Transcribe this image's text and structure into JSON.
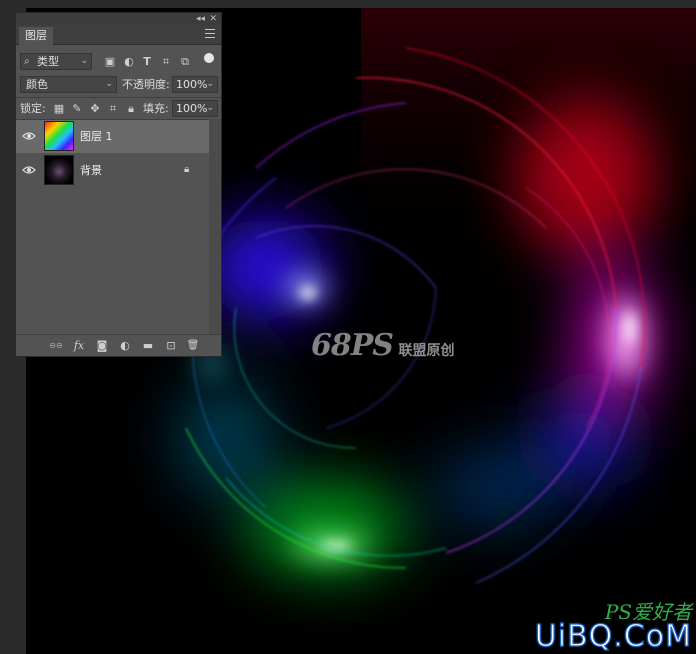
{
  "panel": {
    "title_buttons": {
      "collapse": "◂◂",
      "close": "✕"
    },
    "tab_label": "图层",
    "menu_icon": "panel-menu-icon",
    "filter": {
      "label": "类型",
      "icon": "search-icon",
      "filter_icons": [
        "image-filter-icon",
        "adjustment-filter-icon",
        "type-filter-icon",
        "shape-filter-icon",
        "smart-object-filter-icon",
        "filter-toggle-icon"
      ]
    },
    "blend_mode": "颜色",
    "opacity_label": "不透明度:",
    "opacity_value": "100%",
    "lock_label": "锁定:",
    "lock_icons": [
      "lock-transparent-icon",
      "lock-pixels-icon",
      "lock-position-icon",
      "lock-artboard-icon",
      "lock-all-icon"
    ],
    "fill_label": "填充:",
    "fill_value": "100%",
    "layers": [
      {
        "name": "图层 1",
        "visible": true,
        "selected": true,
        "locked": false,
        "thumb": "rainbow-gradient"
      },
      {
        "name": "背景",
        "visible": true,
        "selected": false,
        "locked": true,
        "thumb": "dark-swirl"
      }
    ],
    "footer_icons": [
      "link-layers-icon",
      "fx-icon",
      "add-mask-icon",
      "adjustment-layer-icon",
      "new-group-icon",
      "new-layer-icon",
      "delete-layer-icon"
    ],
    "footer_glyphs": {
      "link": "⊖⊖",
      "fx": "fx",
      "mask": "◙",
      "adjust": "◐",
      "group": "▬",
      "new": "⊡",
      "delete": "🗑"
    }
  },
  "canvas": {
    "watermark_logo": "68PS",
    "watermark_text": "联盟原创",
    "site_mark_top": "PS爱好者",
    "site_mark_bottom": "UiBQ.CoM"
  },
  "colors": {
    "accent_red": "#ff1030",
    "accent_blue": "#3040ff",
    "accent_green": "#10e030",
    "accent_cyan": "#10d0f0",
    "panel_bg": "#535353"
  }
}
